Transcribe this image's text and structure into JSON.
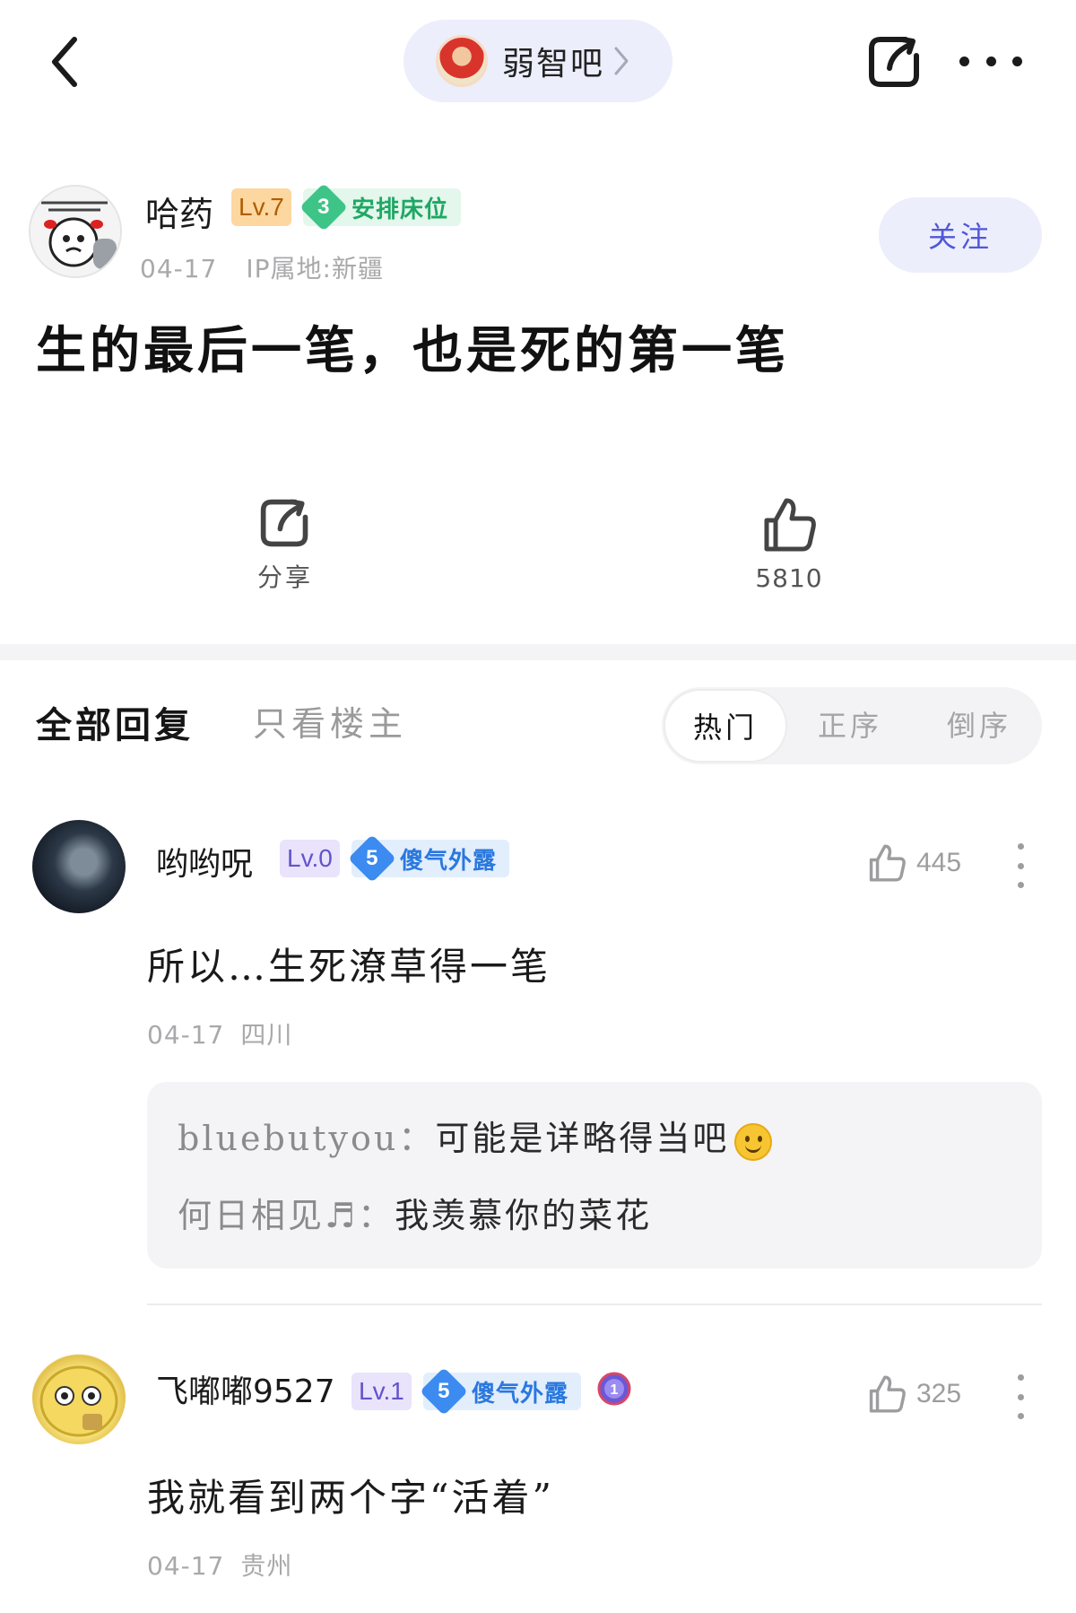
{
  "topbar": {
    "forum_name": "弱智吧"
  },
  "post": {
    "author": {
      "name": "哈药",
      "level": "Lv.7",
      "tag_number": "3",
      "tag_text": "安排床位",
      "date": "04-17",
      "ip": "IP属地:新疆"
    },
    "follow_label": "关注",
    "title": "生的最后一笔，也是死的第一笔",
    "share_label": "分享",
    "like_count": "5810"
  },
  "replies": {
    "tab_all": "全部回复",
    "tab_op_only": "只看楼主",
    "sort": {
      "hot": "热门",
      "ascending": "正序",
      "descending": "倒序",
      "selected": "热门"
    },
    "comments": [
      {
        "name": "哟哟呪",
        "level": "Lv.0",
        "tag_number": "5",
        "tag_text": "傻气外露",
        "likes": "445",
        "text": "所以…生死潦草得一笔",
        "date": "04-17",
        "location": "四川",
        "sub_replies": [
          {
            "who": "bluebutyou：",
            "text": "可能是详略得当吧"
          },
          {
            "who": "何日相见♬：",
            "text": "我羡慕你的菜花"
          }
        ]
      },
      {
        "name": "飞嘟嘟9527",
        "level": "Lv.1",
        "tag_number": "5",
        "tag_text": "傻气外露",
        "medal": "1",
        "likes": "325",
        "text": "我就看到两个字“活着”",
        "date": "04-17",
        "location": "贵州"
      }
    ]
  },
  "colors": {
    "accent": "#5057d8",
    "pill_bg": "#eceefc",
    "green_tag": "#1fa764",
    "blue_tag": "#2a78de",
    "level_orange": "#fdd7a0",
    "level_purple": "#e9e3fb"
  },
  "icons": {
    "back": "chevron-left-icon",
    "share": "share-icon",
    "more": "more-dots-icon",
    "like": "thumbs-up-icon",
    "forum_chevron": "chevron-right-icon"
  }
}
